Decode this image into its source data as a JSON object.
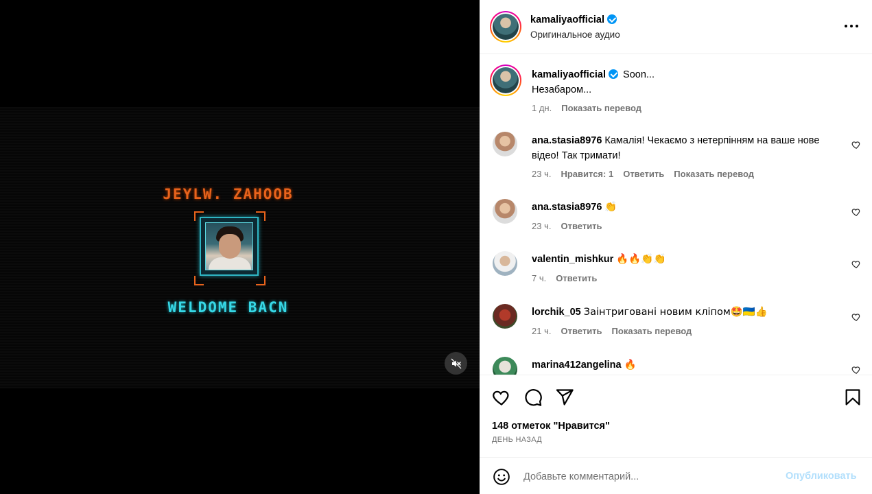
{
  "video": {
    "title": "JEYLW. ZAHOOB",
    "subtitle": "WELDOME BACN"
  },
  "header": {
    "username": "kamaliyaofficial",
    "audio": "Оригинальное аудио"
  },
  "caption": {
    "username": "kamaliyaofficial",
    "text_line1": "Soon...",
    "text_line2": "Незабаром...",
    "time": "1 дн.",
    "translate": "Показать перевод"
  },
  "comments": [
    {
      "username": "ana.stasia8976",
      "text": "Камалія! Чекаємо з нетерпінням на ваше нове відео! Так тримати!",
      "time": "23 ч.",
      "likes": "Нравится: 1",
      "reply": "Ответить",
      "translate": "Показать перевод",
      "avatar_color": "#c8a58a"
    },
    {
      "username": "ana.stasia8976",
      "text": "👏",
      "time": "23 ч.",
      "reply": "Ответить",
      "avatar_color": "#c8a58a"
    },
    {
      "username": "valentin_mishkur",
      "text": "🔥🔥👏👏",
      "time": "7 ч.",
      "reply": "Ответить",
      "avatar_color": "#8aa2b5"
    },
    {
      "username": "lorchik_05",
      "text": "Заінтриговані новим кліпом🤩🇺🇦👍",
      "time": "21 ч.",
      "reply": "Ответить",
      "translate": "Показать перевод",
      "avatar_color": "#7a3b2e"
    },
    {
      "username": "marina412angelina",
      "text": "🔥",
      "avatar_color": "#3d8a5a"
    }
  ],
  "actions": {
    "likes": "148 отметок \"Нравится\"",
    "date": "ДЕНЬ НАЗАД"
  },
  "comment_bar": {
    "placeholder": "Добавьте комментарий...",
    "publish": "Опубликовать"
  },
  "colors": {
    "accent": "#0095f6",
    "publish_disabled": "#b2dffc",
    "video_title": "#e8631c",
    "video_subtitle": "#37d8e6"
  }
}
